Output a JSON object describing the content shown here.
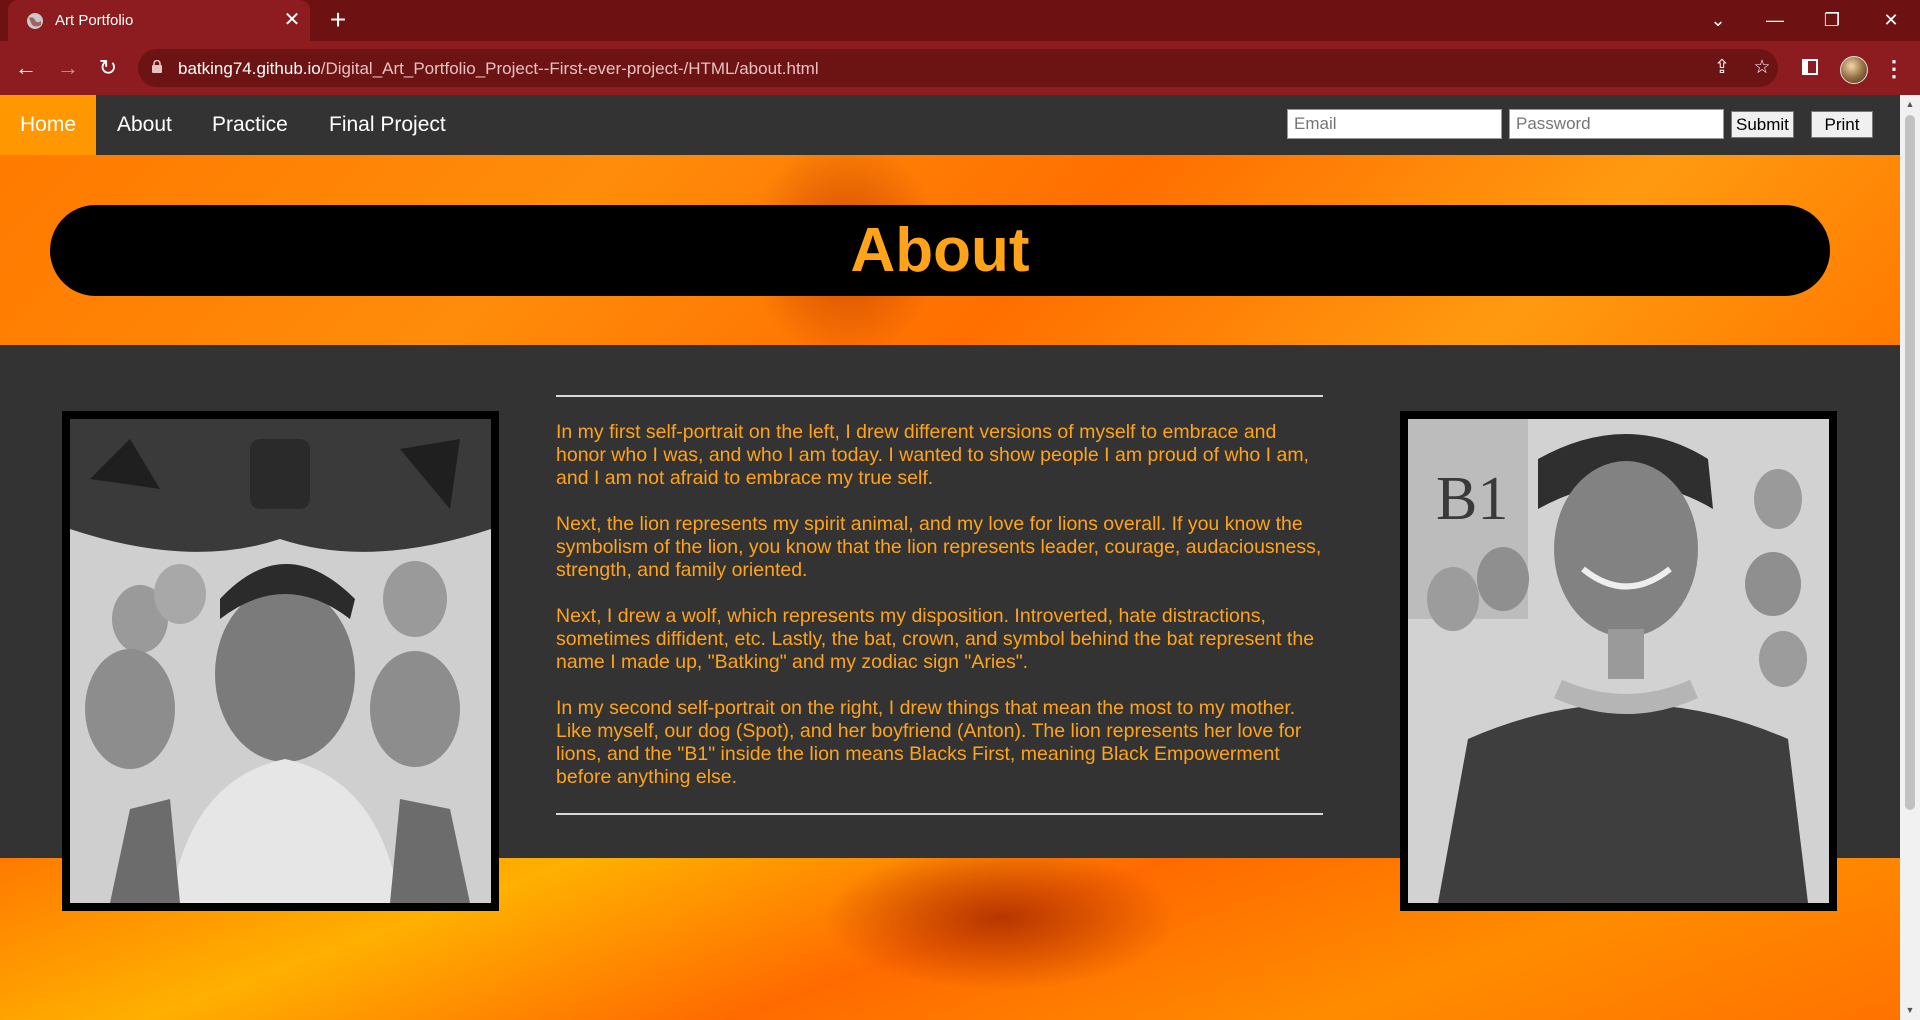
{
  "browser": {
    "tab_title": "Art Portfolio",
    "tab_close": "✕",
    "new_tab": "+",
    "url_domain": "batking74.github.io",
    "url_path": "/Digital_Art_Portfolio_Project--First-ever-project-/HTML/about.html",
    "controls": {
      "tablist": "⌄",
      "minimize": "—",
      "restore": "❐",
      "close": "✕"
    },
    "nav": {
      "back": "←",
      "forward": "→",
      "reload": "↻"
    },
    "share_icon": "⇪",
    "star_icon": "☆",
    "menu_icon": "⋮"
  },
  "topnav": {
    "links": [
      "Home",
      "About",
      "Practice",
      "Final Project"
    ],
    "active": "Home",
    "email_placeholder": "Email",
    "password_placeholder": "Password",
    "submit_label": "Submit",
    "print_label": "Print"
  },
  "page": {
    "heading": "About",
    "paragraphs": [
      "In my first self-portrait on the left, I drew different versions of myself to embrace and honor who I was, and who I am today. I wanted to show people I am proud of who I am, and I am not afraid to embrace my true self.",
      "Next, the lion represents my spirit animal, and my love for lions overall. If you know the symbolism of the lion, you know that the lion represents leader, courage, audaciousness, strength, and family oriented.",
      "Next, I drew a wolf, which represents my disposition. Introverted, hate distractions, sometimes diffident, etc. Lastly, the bat, crown, and symbol behind the bat represent the name I made up, \"Batking\" and my zodiac sign \"Aries\".",
      "In my second self-portrait on the right, I drew things that mean the most to my mother. Like myself, our dog (Spot), and her boyfriend (Anton). The lion represents her love for lions, and the \"B1\" inside the lion means Blacks First, meaning Black Empowerment before anything else."
    ],
    "portrait_mother_text": "B1"
  },
  "colors": {
    "accent": "#ffa31a",
    "nav_bg": "#333333",
    "tab_bar": "#6e1112",
    "toolbar": "#8c1c1f"
  }
}
